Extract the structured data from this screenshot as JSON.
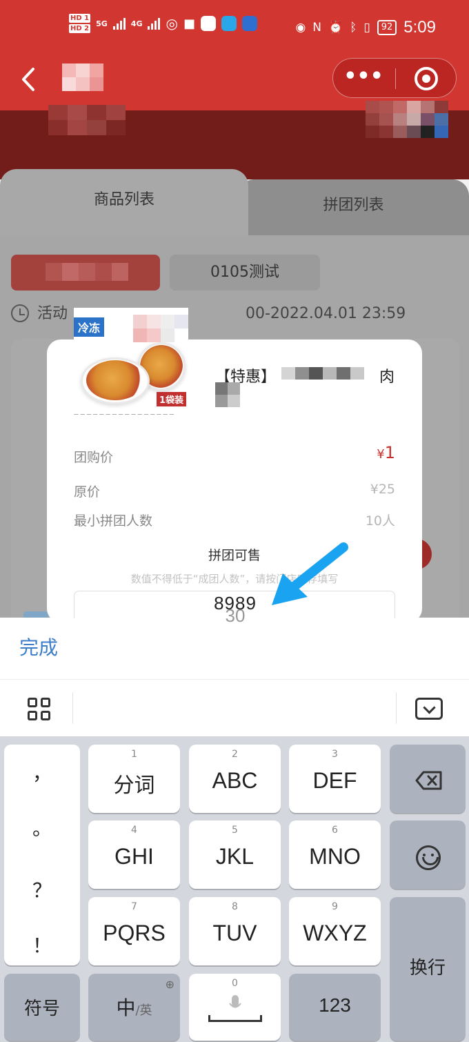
{
  "status_bar": {
    "hd_top": "HD 1",
    "hd_bottom": "HD 2",
    "net_a": "5G",
    "net_b": "4G",
    "battery": "92",
    "time": "5:09",
    "icons": [
      "hotspot-icon",
      "video-icon",
      "app-icon",
      "search-app-icon",
      "bulb-icon",
      "eye-icon",
      "nfc-icon",
      "alarm-icon",
      "bluetooth-icon",
      "vibrate-icon"
    ]
  },
  "header": {
    "back_icon": "chevron-left-icon",
    "more_icon": "•••",
    "close_icon": "target-icon"
  },
  "tabs": {
    "goods": "商品列表",
    "group": "拼团列表"
  },
  "filters": {
    "chip_b": "0105测试"
  },
  "activity": {
    "label": "活动",
    "time": "00-2022.04.01 23:59"
  },
  "product": {
    "brand": "冷冻",
    "pack": "1袋装",
    "title_left": "【特惠】",
    "title_right": "肉"
  },
  "pricing": {
    "group_price_label": "团购价",
    "group_price_currency": "¥",
    "group_price_value": "1",
    "original_price_label": "原价",
    "original_price_value": "¥25",
    "min_group_label": "最小拼团人数",
    "min_group_value": "10人"
  },
  "sale": {
    "title": "拼团可售",
    "hint": "数值不得低于“成团人数”，请按门店库存填写",
    "value": "8989",
    "ghost_value": "30"
  },
  "keyboard_bar": {
    "done": "完成"
  },
  "keyboard": {
    "punct": [
      "，",
      "。",
      "？",
      "！"
    ],
    "keys": [
      {
        "num": "1",
        "label": "分词"
      },
      {
        "num": "2",
        "label": "ABC"
      },
      {
        "num": "3",
        "label": "DEF"
      },
      {
        "num": "4",
        "label": "GHI"
      },
      {
        "num": "5",
        "label": "JKL"
      },
      {
        "num": "6",
        "label": "MNO"
      },
      {
        "num": "7",
        "label": "PQRS"
      },
      {
        "num": "8",
        "label": "TUV"
      },
      {
        "num": "9",
        "label": "WXYZ"
      }
    ],
    "symbols": "符号",
    "lang_main": "中",
    "lang_alt": "/英",
    "space_num": "0",
    "num_key": "123",
    "enter": "换行"
  },
  "colors": {
    "brand_red": "#d23631",
    "link_blue": "#3c7ecb",
    "price_red": "#c9302c",
    "arrow_blue": "#1aa3f0"
  }
}
